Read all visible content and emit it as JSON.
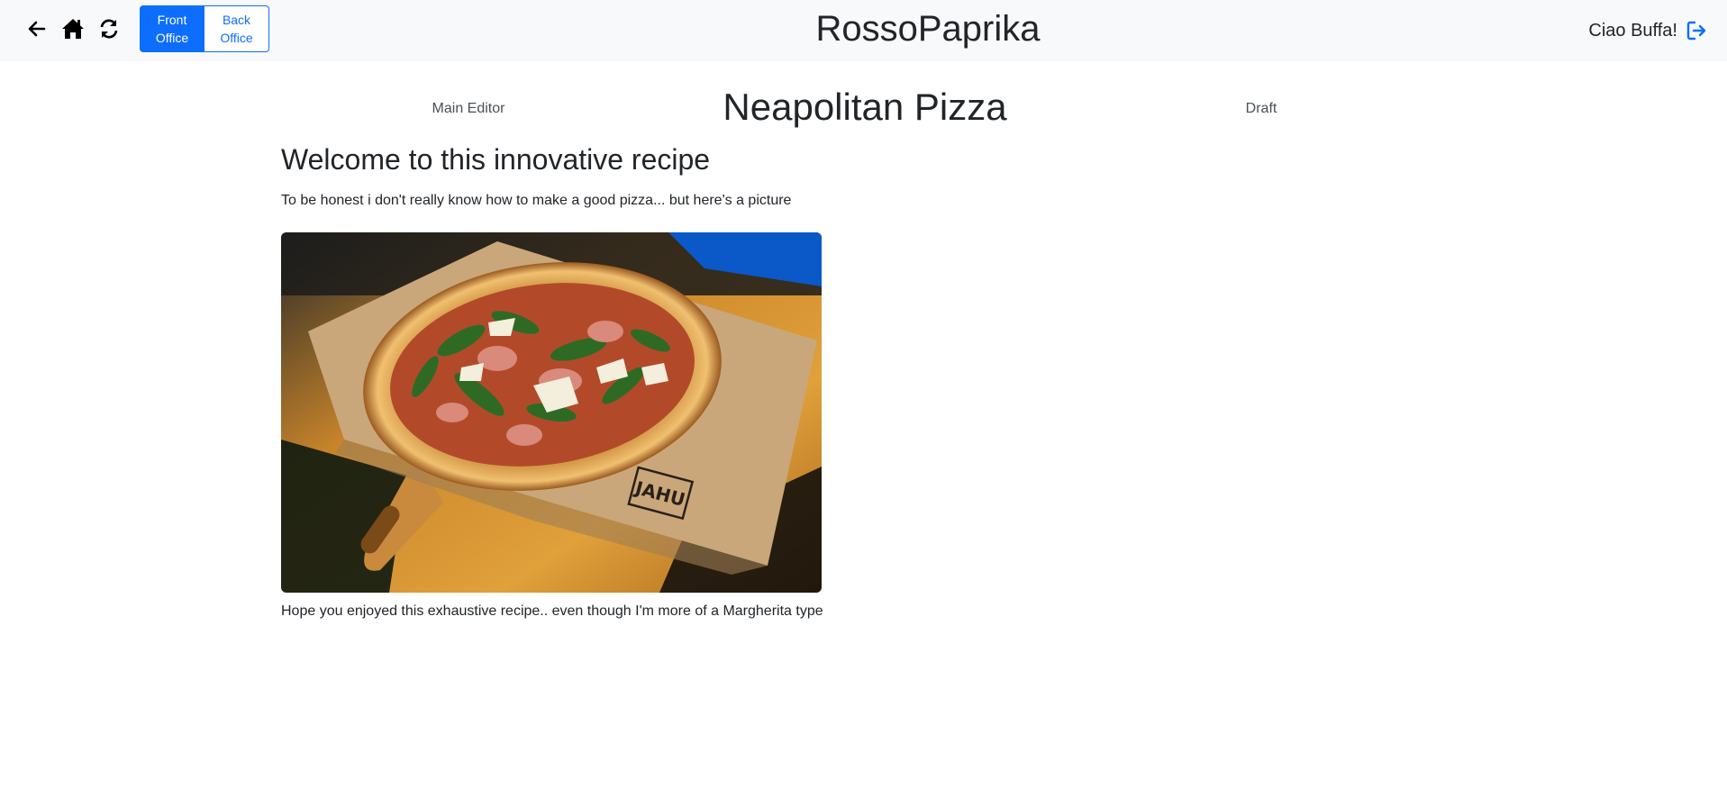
{
  "navbar": {
    "brand": "RossoPaprika",
    "office_toggle": {
      "front_label": "Front\nOffice",
      "back_label": "Back\nOffice",
      "active": "front"
    },
    "greeting": "Ciao Buffa!",
    "icons": {
      "back": "arrow-left-icon",
      "home": "home-icon",
      "reload": "reload-icon",
      "logout": "logout-icon"
    }
  },
  "recipe": {
    "editor_label": "Main Editor",
    "title": "Neapolitan Pizza",
    "status": "Draft",
    "heading": "Welcome to this innovative recipe",
    "intro": "To be honest i don't really know how to make a good pizza... but here's a picture",
    "image_alt": "pizza on a wooden board",
    "image_stamp": "JAHU",
    "outro": "Hope you enjoyed this exhaustive recipe.. even though I'm more of a Margherita type"
  },
  "colors": {
    "primary": "#0d6efd",
    "navbar_bg": "#f8f9fa",
    "text": "#212529",
    "muted": "#495057"
  }
}
